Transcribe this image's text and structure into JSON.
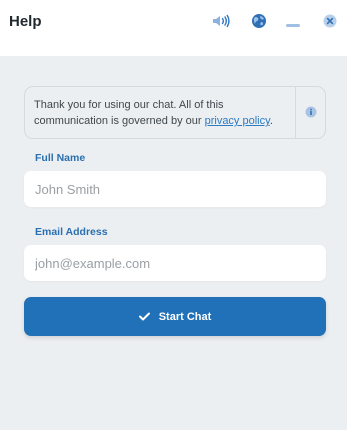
{
  "header": {
    "title": "Help",
    "icons": [
      "sound-icon",
      "globe-icon",
      "minimize-icon",
      "close-icon"
    ]
  },
  "notice": {
    "text": "Thank you for using our chat. All of this communication is governed by our ",
    "link_text": "privacy policy",
    "text_end": "."
  },
  "form": {
    "name_label": "Full Name",
    "name_placeholder": "John Smith",
    "email_label": "Email Address",
    "email_placeholder": "john@example.com",
    "submit_label": "Start Chat"
  },
  "colors": {
    "accent": "#2171b8",
    "label": "#2a6fb0",
    "background": "#eceff1"
  }
}
